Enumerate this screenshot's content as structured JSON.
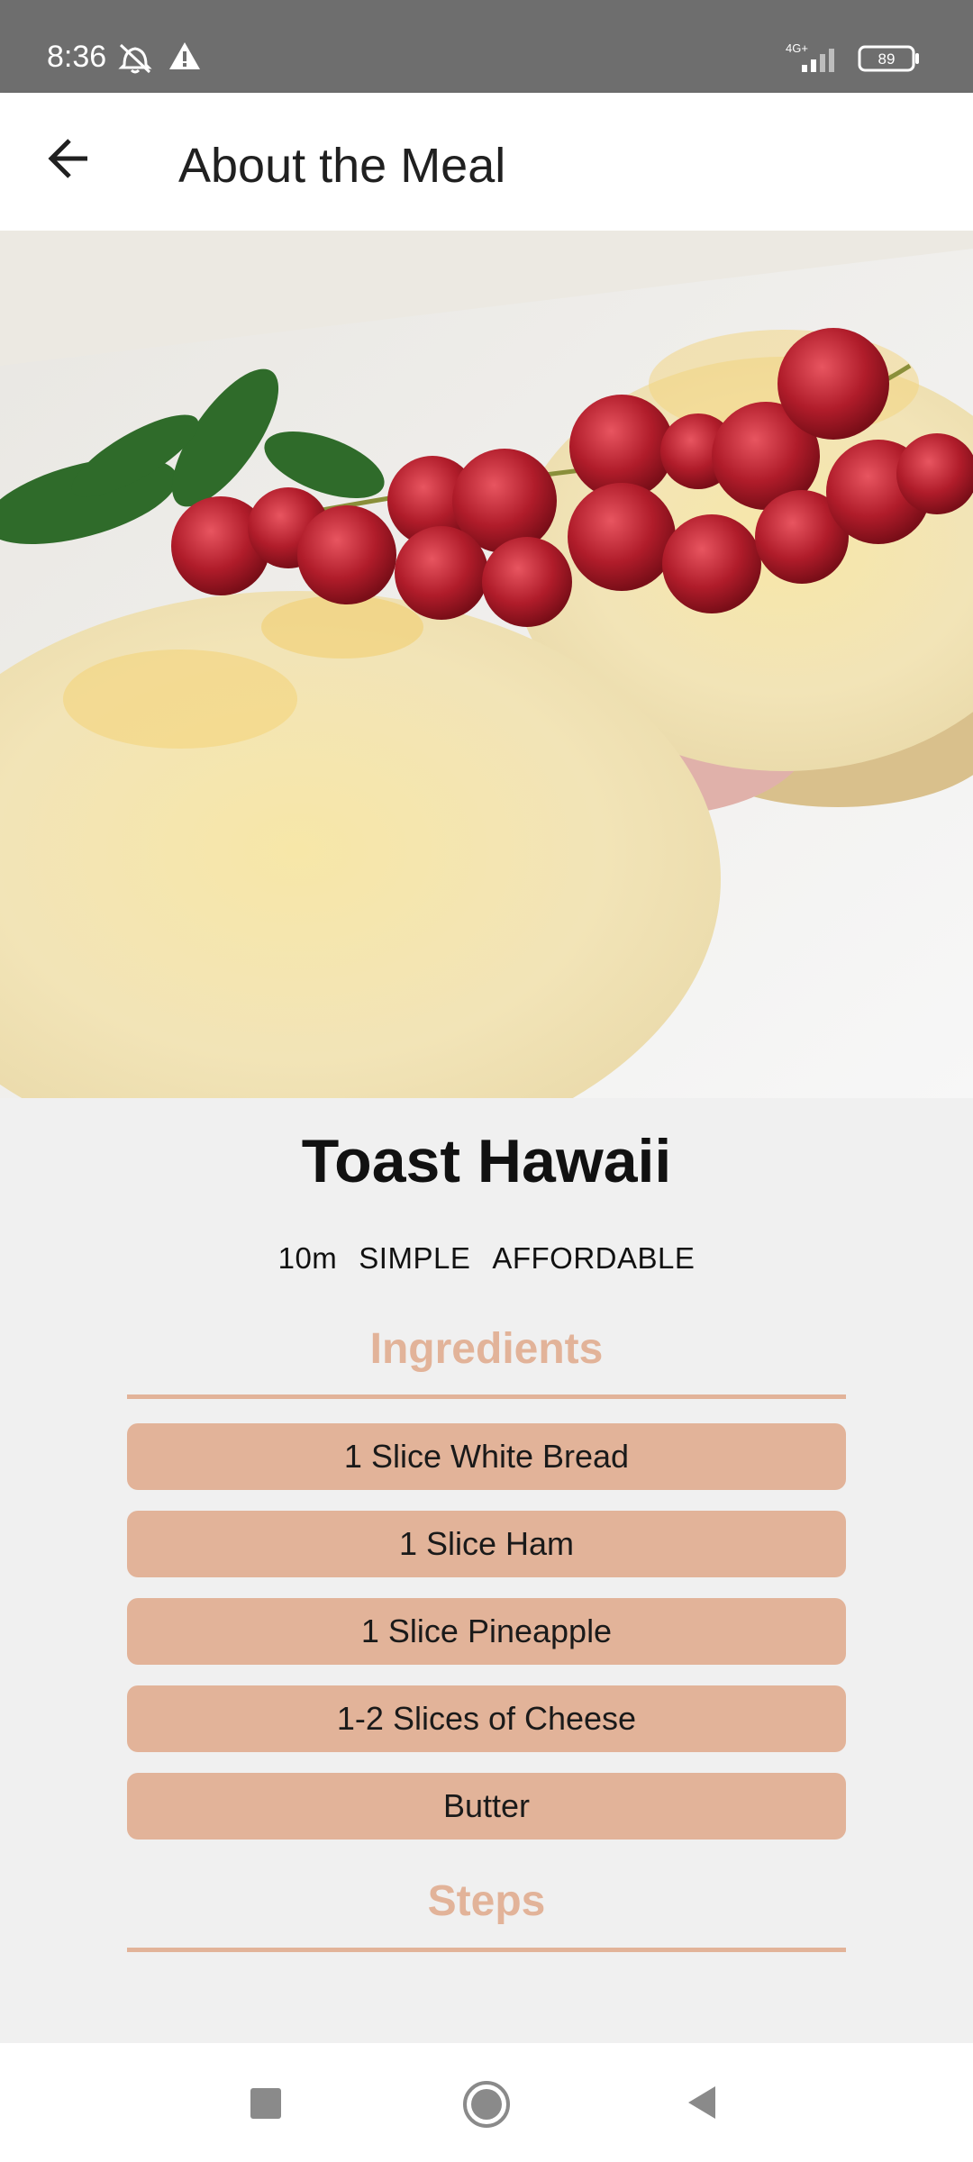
{
  "status_bar": {
    "time": "8:36",
    "network": "4G+",
    "battery": "89",
    "icons": [
      "dnd-icon",
      "warning-icon",
      "signal-icon",
      "battery-icon"
    ]
  },
  "app_bar": {
    "title": "About the Meal",
    "back_icon": "arrow-left-icon"
  },
  "meal": {
    "title": "Toast Hawaii",
    "duration": "10m",
    "complexity": "SIMPLE",
    "affordability": "AFFORDABLE"
  },
  "ingredients": {
    "title": "Ingredients",
    "items": [
      "1 Slice White Bread",
      "1 Slice Ham",
      "1 Slice Pineapple",
      "1-2 Slices of Cheese",
      "Butter"
    ]
  },
  "steps": {
    "title": "Steps"
  },
  "nav_bar": {
    "icons": [
      "recents-square-icon",
      "home-circle-icon",
      "back-triangle-icon"
    ]
  },
  "colors": {
    "accent": "#e2b399",
    "background": "#f0f0f0",
    "status_bar": "#6e6e6e"
  }
}
